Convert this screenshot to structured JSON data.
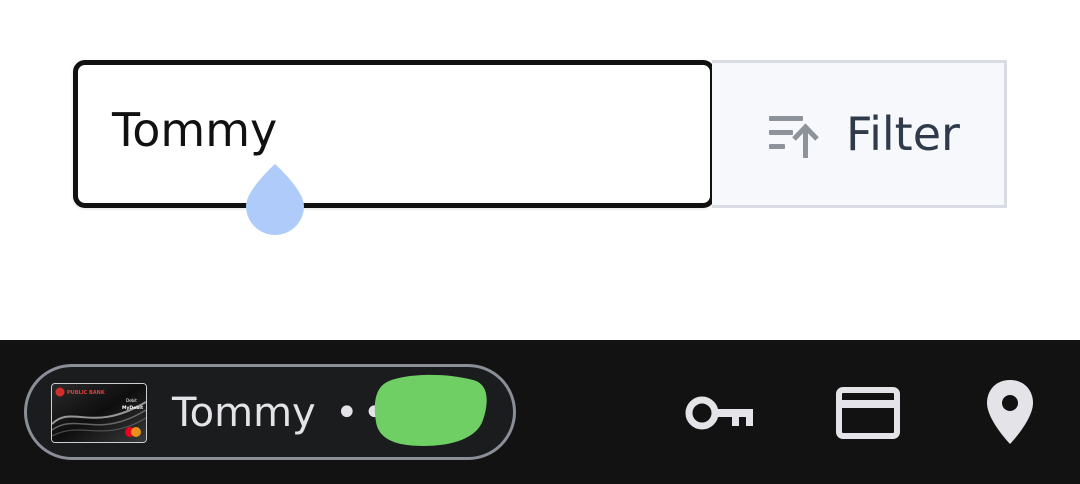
{
  "search": {
    "value": "Tommy"
  },
  "filter": {
    "label": "Filter",
    "icon": "sort-ascending-icon"
  },
  "autofill": {
    "suggestion": {
      "name": "Tommy",
      "masked_suffix": "••",
      "card_brand_text": "PUBLIC BANK",
      "card_type_text": "Debit",
      "card_network_text": "MyDebit"
    },
    "actions": [
      {
        "name": "key-icon"
      },
      {
        "name": "credit-card-icon"
      },
      {
        "name": "location-pin-icon"
      }
    ]
  },
  "colors": {
    "caret_handle": "#aecbfa",
    "bar_background": "#121212",
    "chip_text": "#e3e3e8",
    "filter_text": "#2f3a4b",
    "redacted_green": "#6fcf65"
  }
}
